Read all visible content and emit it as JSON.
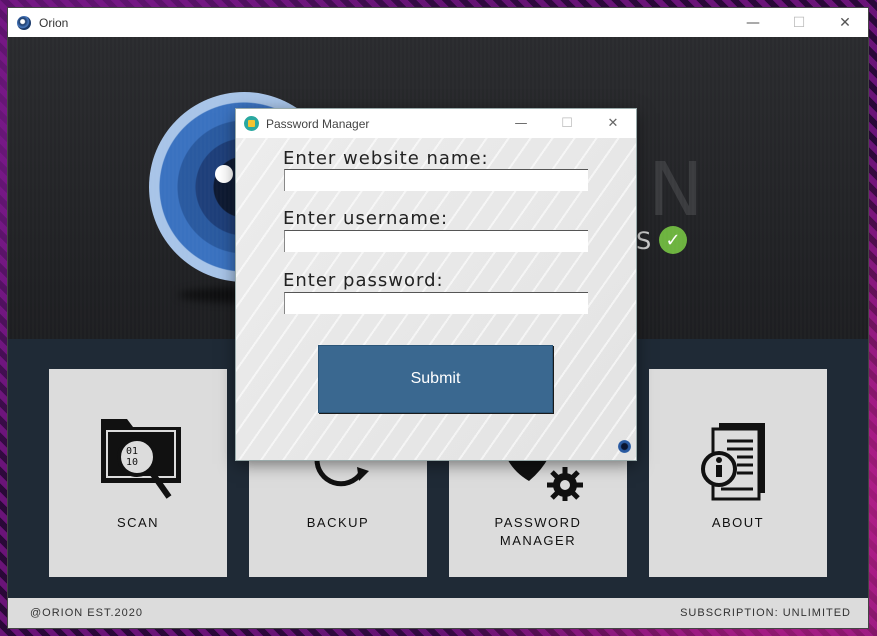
{
  "main_window": {
    "title": "Orion",
    "icon": "orion-logo-icon",
    "controls": {
      "minimize": "—",
      "maximize": "☐",
      "close": "✕"
    }
  },
  "hero": {
    "brand_partial_letter": "N",
    "brand_partial_sub": "S",
    "badge_icon": "check-circle-icon",
    "badge_glyph": "✓"
  },
  "tiles": [
    {
      "label": "SCAN",
      "icon": "scan-folder-icon"
    },
    {
      "label": "BACKUP",
      "icon": "backup-sync-icon"
    },
    {
      "label_line1": "PASSWORD",
      "label_line2": "MANAGER",
      "icon": "password-shield-gear-icon"
    },
    {
      "label": "ABOUT",
      "icon": "about-document-info-icon"
    }
  ],
  "footer": {
    "left": "@ORION EST.2020",
    "right": "SUBSCRIPTION: UNLIMITED"
  },
  "dialog": {
    "title": "Password Manager",
    "icon": "lock-icon",
    "controls": {
      "minimize": "—",
      "maximize": "☐",
      "close": "✕"
    },
    "fields": [
      {
        "label": "Enter website name:",
        "value": ""
      },
      {
        "label": "Enter username:",
        "value": ""
      },
      {
        "label": "Enter password:",
        "value": ""
      }
    ],
    "submit_label": "Submit",
    "corner_icon": "orion-logo-icon"
  },
  "colors": {
    "accent": "#3a6890",
    "tile_bg": "#dcdcdc",
    "hero_bg": "#1e1f22",
    "badge": "#6db33f"
  }
}
